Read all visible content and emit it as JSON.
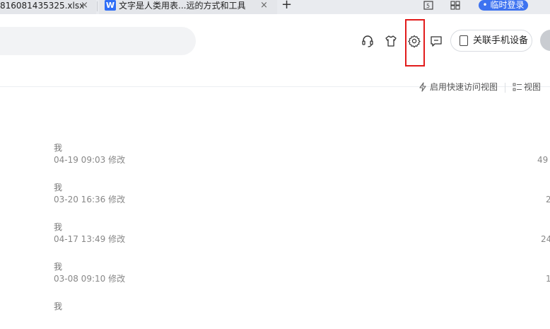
{
  "tabs": [
    {
      "title": "81608143532​5.xlsx",
      "close": "×"
    },
    {
      "title": "文字是人类用表...远的方式和工具",
      "logo": "W",
      "close": "×"
    }
  ],
  "new_tab": "+",
  "login_button": "• 临时登录",
  "header": {
    "icons": [
      "headset-icon",
      "tshirt-icon",
      "gear-icon",
      "chat-icon"
    ],
    "link_phone_label": "关联手机设备"
  },
  "toolbar": {
    "quick_view_label": "启用快速访问视图",
    "view_label": "视图"
  },
  "files": [
    {
      "owner": "我",
      "modified": "04-19 09:03 修改",
      "size": "49"
    },
    {
      "owner": "我",
      "modified": "03-20 16:36 修改",
      "size": "2"
    },
    {
      "owner": "我",
      "modified": "04-17 13:49 修改",
      "size": "24"
    },
    {
      "owner": "我",
      "modified": "03-08 09:10 修改",
      "size": "1"
    },
    {
      "owner": "我",
      "modified": "",
      "size": ""
    }
  ],
  "colors": {
    "accent": "#3e73f0",
    "highlight": "#e21b1b"
  }
}
